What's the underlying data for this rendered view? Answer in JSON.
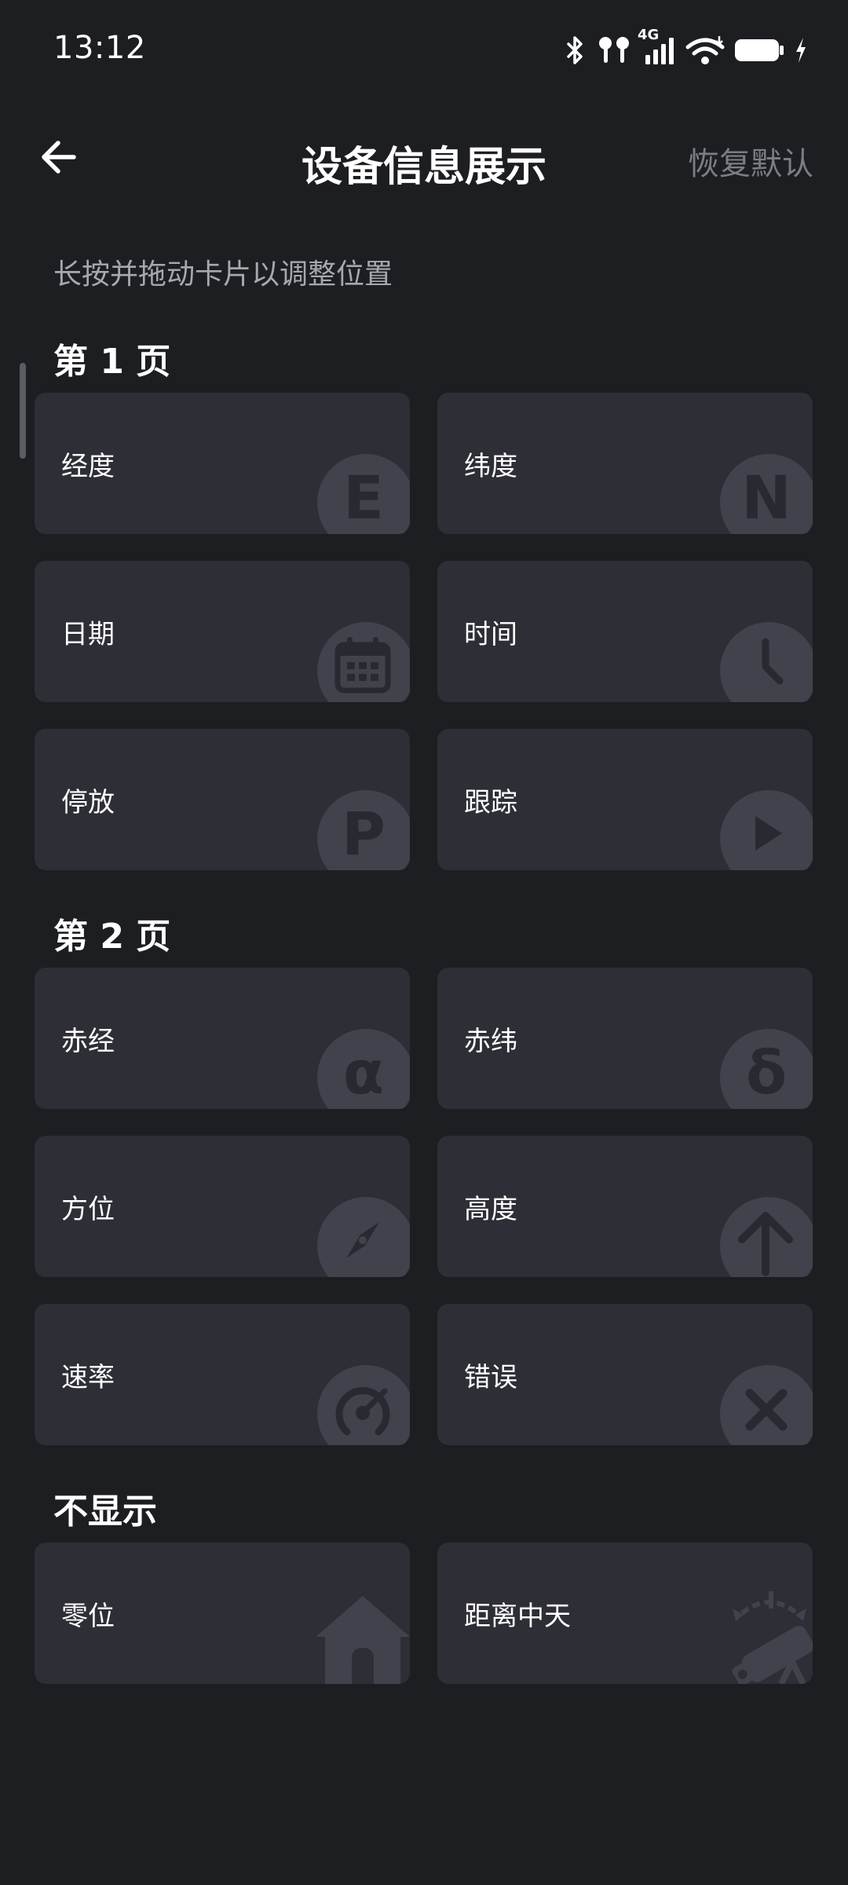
{
  "status_bar": {
    "time": "13:12",
    "network": "4G"
  },
  "header": {
    "title": "设备信息展示",
    "reset_label": "恢复默认"
  },
  "hint": "长按并拖动卡片以调整位置",
  "sections": [
    {
      "title": "第 1 页",
      "cards": [
        {
          "label": "经度",
          "icon": "letter-e-icon",
          "glyph": "E"
        },
        {
          "label": "纬度",
          "icon": "letter-n-icon",
          "glyph": "N"
        },
        {
          "label": "日期",
          "icon": "calendar-icon"
        },
        {
          "label": "时间",
          "icon": "clock-icon"
        },
        {
          "label": "停放",
          "icon": "parking-icon",
          "glyph": "P"
        },
        {
          "label": "跟踪",
          "icon": "play-icon"
        }
      ]
    },
    {
      "title": "第 2 页",
      "cards": [
        {
          "label": "赤经",
          "icon": "alpha-icon",
          "glyph": "α"
        },
        {
          "label": "赤纬",
          "icon": "delta-icon",
          "glyph": "δ"
        },
        {
          "label": "方位",
          "icon": "compass-icon"
        },
        {
          "label": "高度",
          "icon": "arrow-up-icon"
        },
        {
          "label": "速率",
          "icon": "speedometer-icon"
        },
        {
          "label": "错误",
          "icon": "close-icon"
        }
      ]
    },
    {
      "title": "不显示",
      "cards": [
        {
          "label": "零位",
          "icon": "home-icon"
        },
        {
          "label": "距离中天",
          "icon": "telescope-icon"
        }
      ]
    }
  ]
}
